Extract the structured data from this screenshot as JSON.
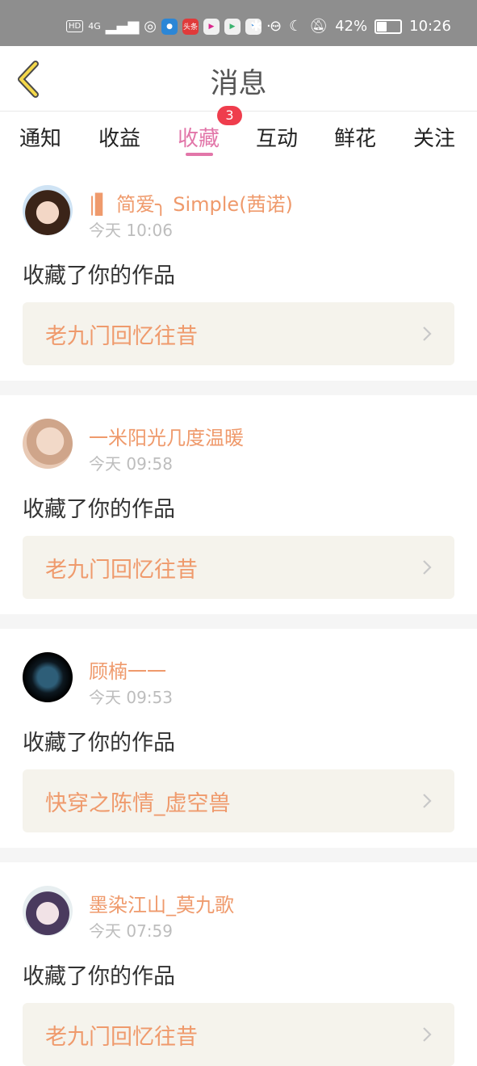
{
  "status_bar": {
    "network_tag": "HD",
    "signal": "4G",
    "app1": "头条",
    "more": "···",
    "battery": "42%",
    "time": "10:26"
  },
  "header": {
    "title": "消息"
  },
  "tabs": [
    {
      "label": "通知"
    },
    {
      "label": "收益"
    },
    {
      "label": "收藏",
      "active": true,
      "badge": "3"
    },
    {
      "label": "互动"
    },
    {
      "label": "鲜花"
    },
    {
      "label": "关注"
    }
  ],
  "messages": [
    {
      "name": "|▌ 简爱╮ Simple(茜诺)",
      "time": "今天 10:06",
      "action": "收藏了你的作品",
      "work": "老九门回忆往昔"
    },
    {
      "name": "一米阳光几度温暖",
      "time": "今天 09:58",
      "action": "收藏了你的作品",
      "work": "老九门回忆往昔"
    },
    {
      "name": "顾楠一一",
      "time": "今天 09:53",
      "action": "收藏了你的作品",
      "work": "快穿之陈情_虚空兽"
    },
    {
      "name": "墨染江山_莫九歌",
      "time": "今天 07:59",
      "action": "收藏了你的作品",
      "work": "老九门回忆往昔"
    }
  ],
  "colors": {
    "accent": "#e276a9",
    "name": "#ef9a6c",
    "badge": "#ef3d4d",
    "work_bg": "#f5f3ec"
  }
}
